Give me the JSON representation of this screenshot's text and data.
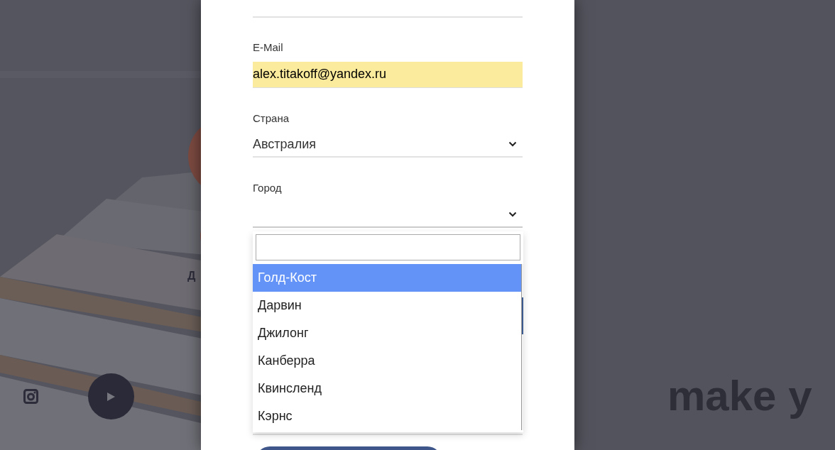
{
  "background": {
    "heading_fragment": "Д",
    "tagline": "make y"
  },
  "form": {
    "fields": [
      {
        "kind": "text",
        "label": "E-Mail",
        "value": "alex.titakoff@yandex.ru",
        "autofilled": true
      },
      {
        "kind": "select",
        "label": "Страна",
        "value": "Австралия",
        "expanded": false
      },
      {
        "kind": "select",
        "label": "Город",
        "expanded": true
      }
    ]
  },
  "dropdown": {
    "options": [
      {
        "label": "Голд-Кост",
        "selected": true
      },
      {
        "label": "Дарвин",
        "selected": false
      },
      {
        "label": "Джилонг",
        "selected": false
      },
      {
        "label": "Канберра",
        "selected": false
      },
      {
        "label": "Квинсленд",
        "selected": false
      },
      {
        "label": "Кэрнс",
        "selected": false
      }
    ]
  }
}
